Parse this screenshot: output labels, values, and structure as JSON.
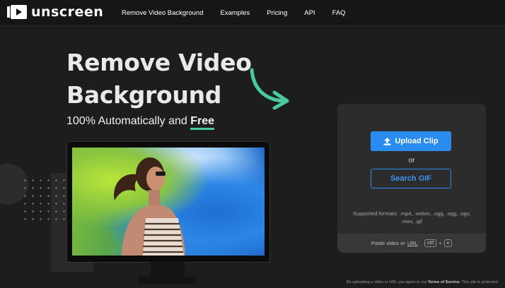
{
  "brand": {
    "name": "unscreen",
    "logo_icon": "play-screen-icon"
  },
  "nav": {
    "links": [
      "Remove Video Background",
      "Examples",
      "Pricing",
      "API",
      "FAQ"
    ]
  },
  "hero": {
    "title_line1": "Remove Video",
    "title_line2": "Background",
    "subtitle_prefix": "100% Automatically and",
    "subtitle_emphasis": "Free",
    "accent_color": "#48c9a0"
  },
  "upload": {
    "upload_label": "Upload Clip",
    "or_label": "or",
    "gif_label": "Search GIF",
    "formats_text": "Supported formats: .mp4, .webm, .ogg, .ogg, .ogv, .mov, .gif",
    "paste_prefix": "Paste video or",
    "paste_url": "URL",
    "key_ctrl": "ctrl",
    "key_plus": "+",
    "key_v": "v",
    "button_color": "#2a8cf0"
  },
  "legal": {
    "prefix": "By uploading a video or URL you agree to our",
    "terms": "Terms of Service.",
    "suffix": "This site is protected"
  }
}
